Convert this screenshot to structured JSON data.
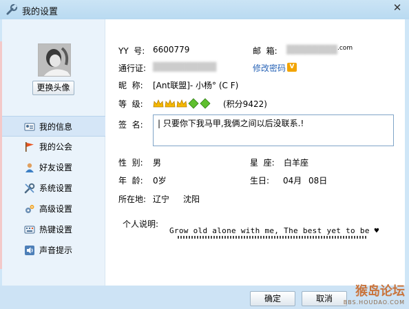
{
  "window": {
    "title": "我的设置",
    "close_glyph": "✕"
  },
  "left": {
    "change_avatar_label": "更换头像",
    "nav": [
      {
        "label": "我的信息",
        "icon": "id-card-icon",
        "active": true
      },
      {
        "label": "我的公会",
        "icon": "flag-icon"
      },
      {
        "label": "好友设置",
        "icon": "person-icon"
      },
      {
        "label": "系统设置",
        "icon": "wrench-icon"
      },
      {
        "label": "高级设置",
        "icon": "gears-icon"
      },
      {
        "label": "热键设置",
        "icon": "keyboard-icon"
      },
      {
        "label": "声音提示",
        "icon": "speaker-icon"
      }
    ]
  },
  "profile": {
    "yy_label": "YY  号:",
    "yy_value": "6600779",
    "email_label": "邮  箱:",
    "email_value": ".com",
    "pass_label": "通行证:",
    "pass_value": "",
    "modify_link": "修改密码",
    "v_badge": "V",
    "nick_label": "昵  称:",
    "nick_value": "[Ant联盟]- 小杨° (C F)",
    "level_label": "等  级:",
    "level_score": "(积分9422)",
    "sign_label": "签  名:",
    "sign_value": "| 只要你下我马甲,我俩之间以后没联系.!",
    "gender_label": "性  别:",
    "gender_value": "男",
    "star_label": "星  座:",
    "star_value": "白羊座",
    "age_label": "年  龄:",
    "age_value": "0岁",
    "birthday_label": "生日:",
    "birthday_month": "04月",
    "birthday_day": "08日",
    "location_label": "所在地:",
    "location_province": "辽宁",
    "location_city": "沈阳",
    "desc_label": "个人说明:",
    "desc_value": "Grow old alone with me, The best yet to be ♥"
  },
  "buttons": {
    "ok": "确定",
    "cancel": "取消"
  },
  "watermark": {
    "main": "猴岛论坛",
    "sub": "BBS.HOUDAO.COM"
  }
}
